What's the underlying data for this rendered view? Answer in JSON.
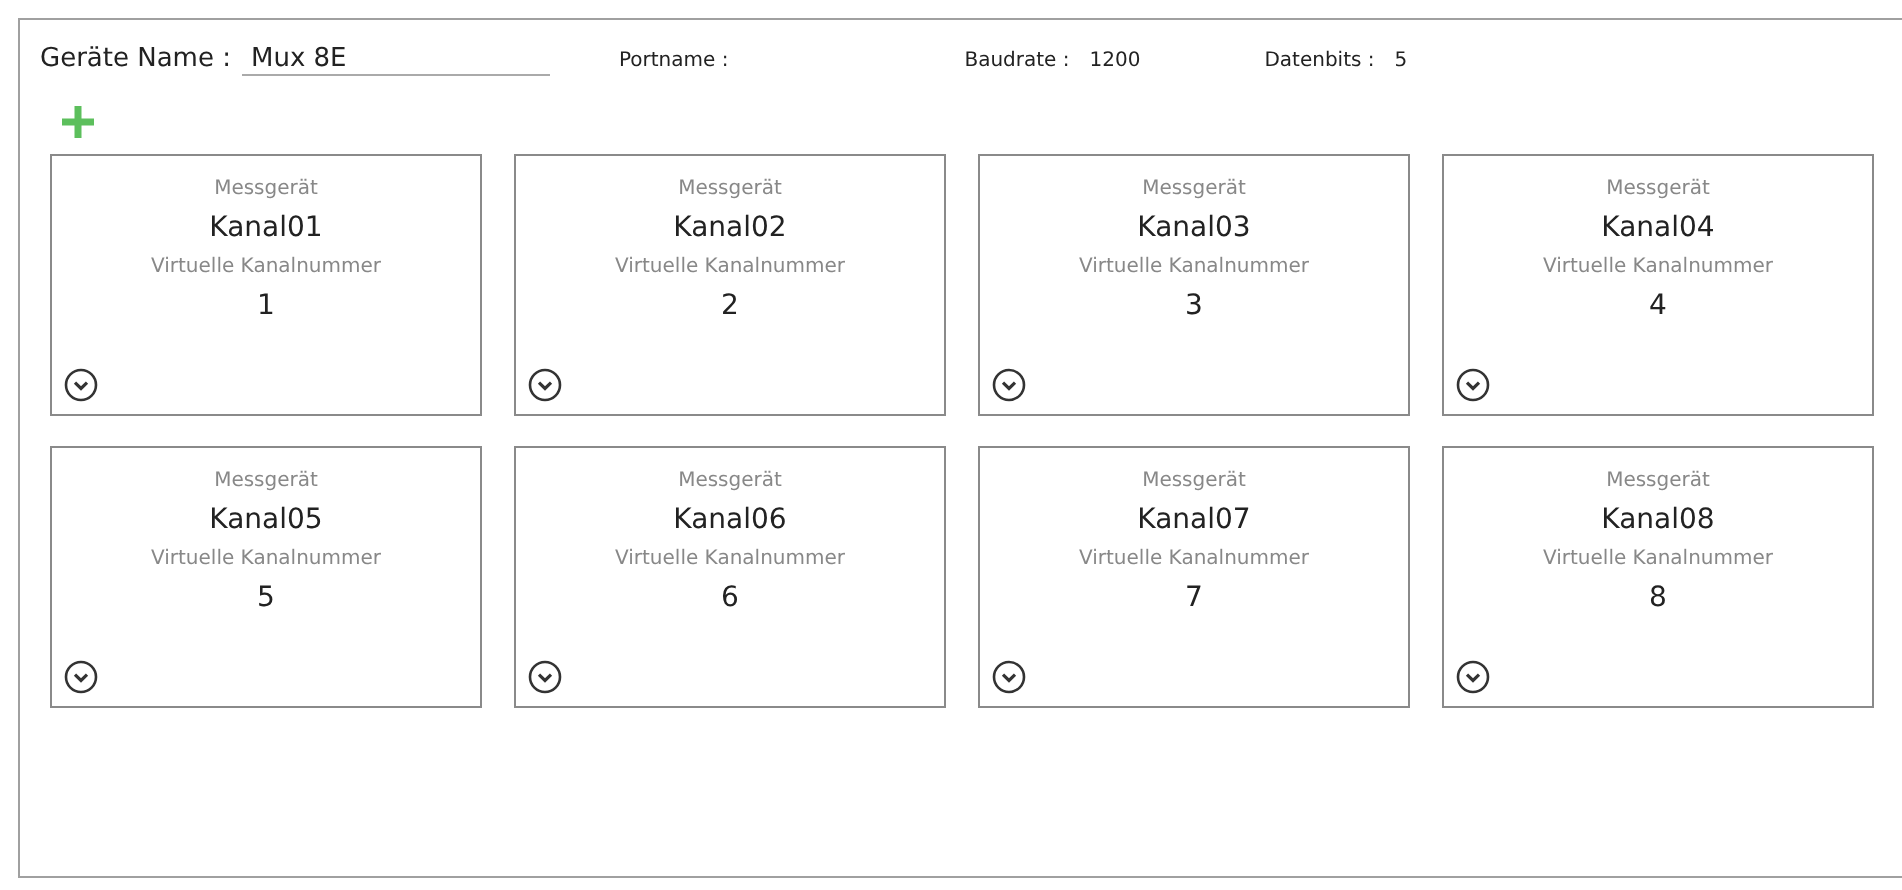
{
  "device": {
    "name_label": "Geräte Name :",
    "name_value": "Mux 8E",
    "port_label": "Portname :",
    "baud_label": "Baudrate :",
    "baud_value": "1200",
    "bits_label": "Datenbits :",
    "bits_value": "5"
  },
  "channels": [
    {
      "type_label": "Messgerät",
      "name": "Kanal01",
      "number_label": "Virtuelle Kanalnummer",
      "number": "1"
    },
    {
      "type_label": "Messgerät",
      "name": "Kanal02",
      "number_label": "Virtuelle Kanalnummer",
      "number": "2"
    },
    {
      "type_label": "Messgerät",
      "name": "Kanal03",
      "number_label": "Virtuelle Kanalnummer",
      "number": "3"
    },
    {
      "type_label": "Messgerät",
      "name": "Kanal04",
      "number_label": "Virtuelle Kanalnummer",
      "number": "4"
    },
    {
      "type_label": "Messgerät",
      "name": "Kanal05",
      "number_label": "Virtuelle Kanalnummer",
      "number": "5"
    },
    {
      "type_label": "Messgerät",
      "name": "Kanal06",
      "number_label": "Virtuelle Kanalnummer",
      "number": "6"
    },
    {
      "type_label": "Messgerät",
      "name": "Kanal07",
      "number_label": "Virtuelle Kanalnummer",
      "number": "7"
    },
    {
      "type_label": "Messgerät",
      "name": "Kanal08",
      "number_label": "Virtuelle Kanalnummer",
      "number": "8"
    }
  ]
}
